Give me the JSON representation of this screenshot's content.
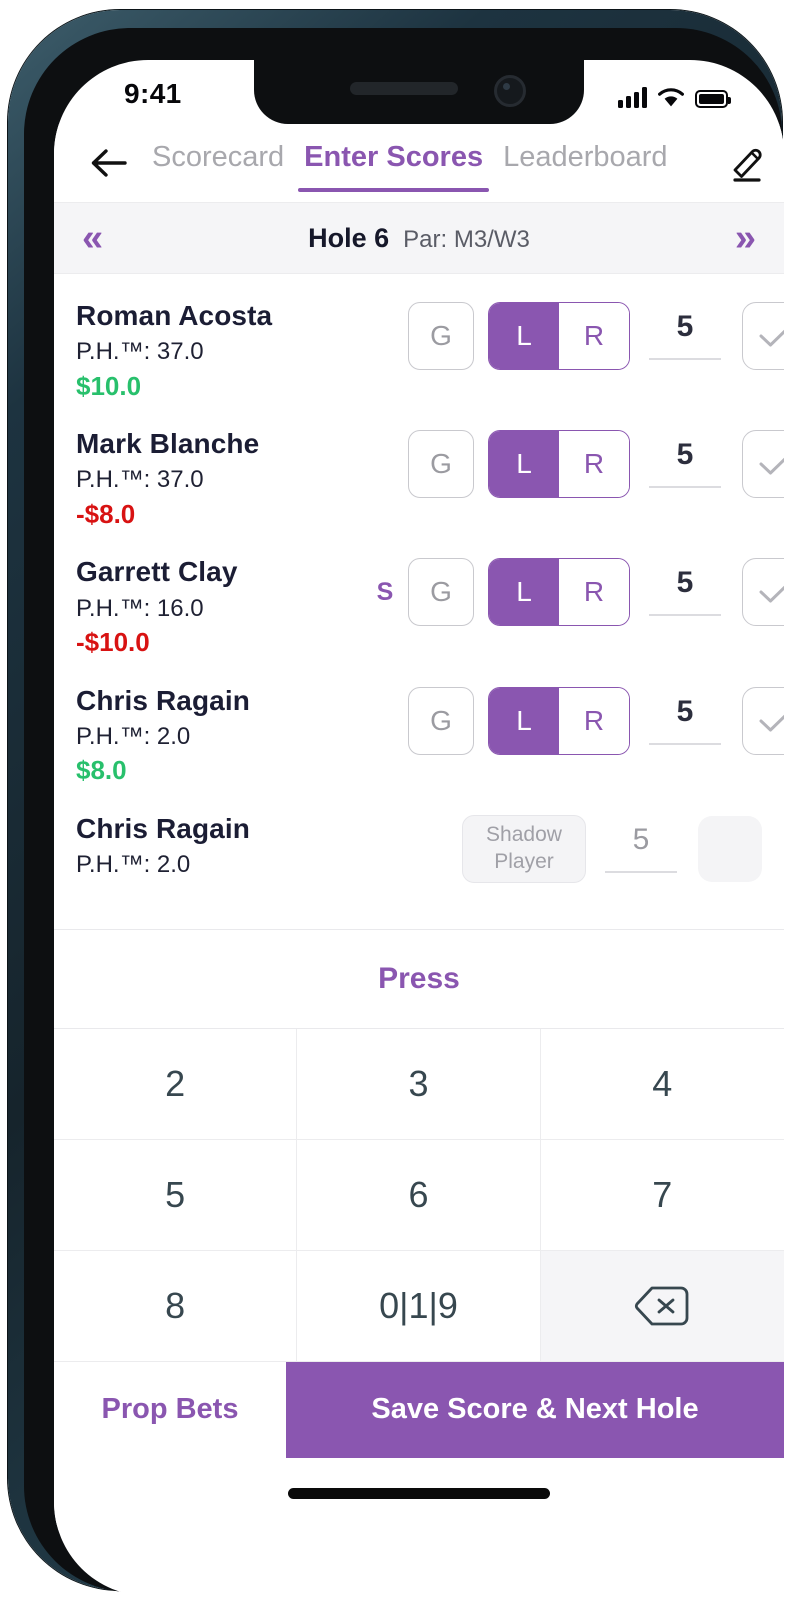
{
  "status_bar": {
    "time": "9:41",
    "cellular_icon": "signal-bars-icon",
    "wifi_icon": "wifi-icon",
    "battery_icon": "battery-full-icon"
  },
  "header": {
    "back_icon": "back-arrow-icon",
    "edit_icon": "pencil-edit-icon",
    "tabs": [
      {
        "label": "Scorecard",
        "active": false
      },
      {
        "label": "Enter Scores",
        "active": true
      },
      {
        "label": "Leaderboard",
        "active": false
      }
    ]
  },
  "hole_bar": {
    "prev_icon": "double-chevron-left-icon",
    "next_icon": "double-chevron-right-icon",
    "hole_label": "Hole 6",
    "par_label": "Par: M3/W3"
  },
  "players": [
    {
      "name": "Roman Acosta",
      "handicap": "P.H.™: 37.0",
      "money": "$10.0",
      "money_state": "positive",
      "stroke_marker": "",
      "g_label": "G",
      "lr": {
        "left_label": "L",
        "right_label": "R",
        "selected": "L"
      },
      "score": "5",
      "check_icon": "checkmark-icon",
      "shadow": false
    },
    {
      "name": "Mark Blanche",
      "handicap": "P.H.™: 37.0",
      "money": "-$8.0",
      "money_state": "negative",
      "stroke_marker": "",
      "g_label": "G",
      "lr": {
        "left_label": "L",
        "right_label": "R",
        "selected": "L"
      },
      "score": "5",
      "check_icon": "checkmark-icon",
      "shadow": false
    },
    {
      "name": "Garrett Clay",
      "handicap": "P.H.™: 16.0",
      "money": "-$10.0",
      "money_state": "negative",
      "stroke_marker": "S",
      "g_label": "G",
      "lr": {
        "left_label": "L",
        "right_label": "R",
        "selected": "L"
      },
      "score": "5",
      "check_icon": "checkmark-icon",
      "shadow": false
    },
    {
      "name": "Chris Ragain",
      "handicap": "P.H.™: 2.0",
      "money": "$8.0",
      "money_state": "positive",
      "stroke_marker": "",
      "g_label": "G",
      "lr": {
        "left_label": "L",
        "right_label": "R",
        "selected": "L"
      },
      "score": "5",
      "check_icon": "checkmark-icon",
      "shadow": false
    },
    {
      "name": "Chris Ragain",
      "handicap": "P.H.™: 2.0",
      "money": "",
      "money_state": "none",
      "stroke_marker": "",
      "shadow": true,
      "shadow_label_line1": "Shadow",
      "shadow_label_line2": "Player",
      "score": "5"
    }
  ],
  "press": {
    "label": "Press"
  },
  "keypad": {
    "keys": [
      {
        "label": "2",
        "type": "digit"
      },
      {
        "label": "3",
        "type": "digit"
      },
      {
        "label": "4",
        "type": "digit"
      },
      {
        "label": "5",
        "type": "digit"
      },
      {
        "label": "6",
        "type": "digit"
      },
      {
        "label": "7",
        "type": "digit"
      },
      {
        "label": "8",
        "type": "digit"
      },
      {
        "label": "0|1|9",
        "type": "multi"
      },
      {
        "label": "",
        "type": "backspace",
        "icon": "backspace-icon"
      }
    ]
  },
  "footer": {
    "prop_bets_label": "Prop Bets",
    "save_label": "Save Score & Next Hole"
  },
  "colors": {
    "accent_purple": "#8a56b0",
    "money_positive": "#28c06c",
    "money_negative": "#d81212",
    "text_dark": "#1b1d34",
    "text_muted": "#a8a8ad"
  }
}
